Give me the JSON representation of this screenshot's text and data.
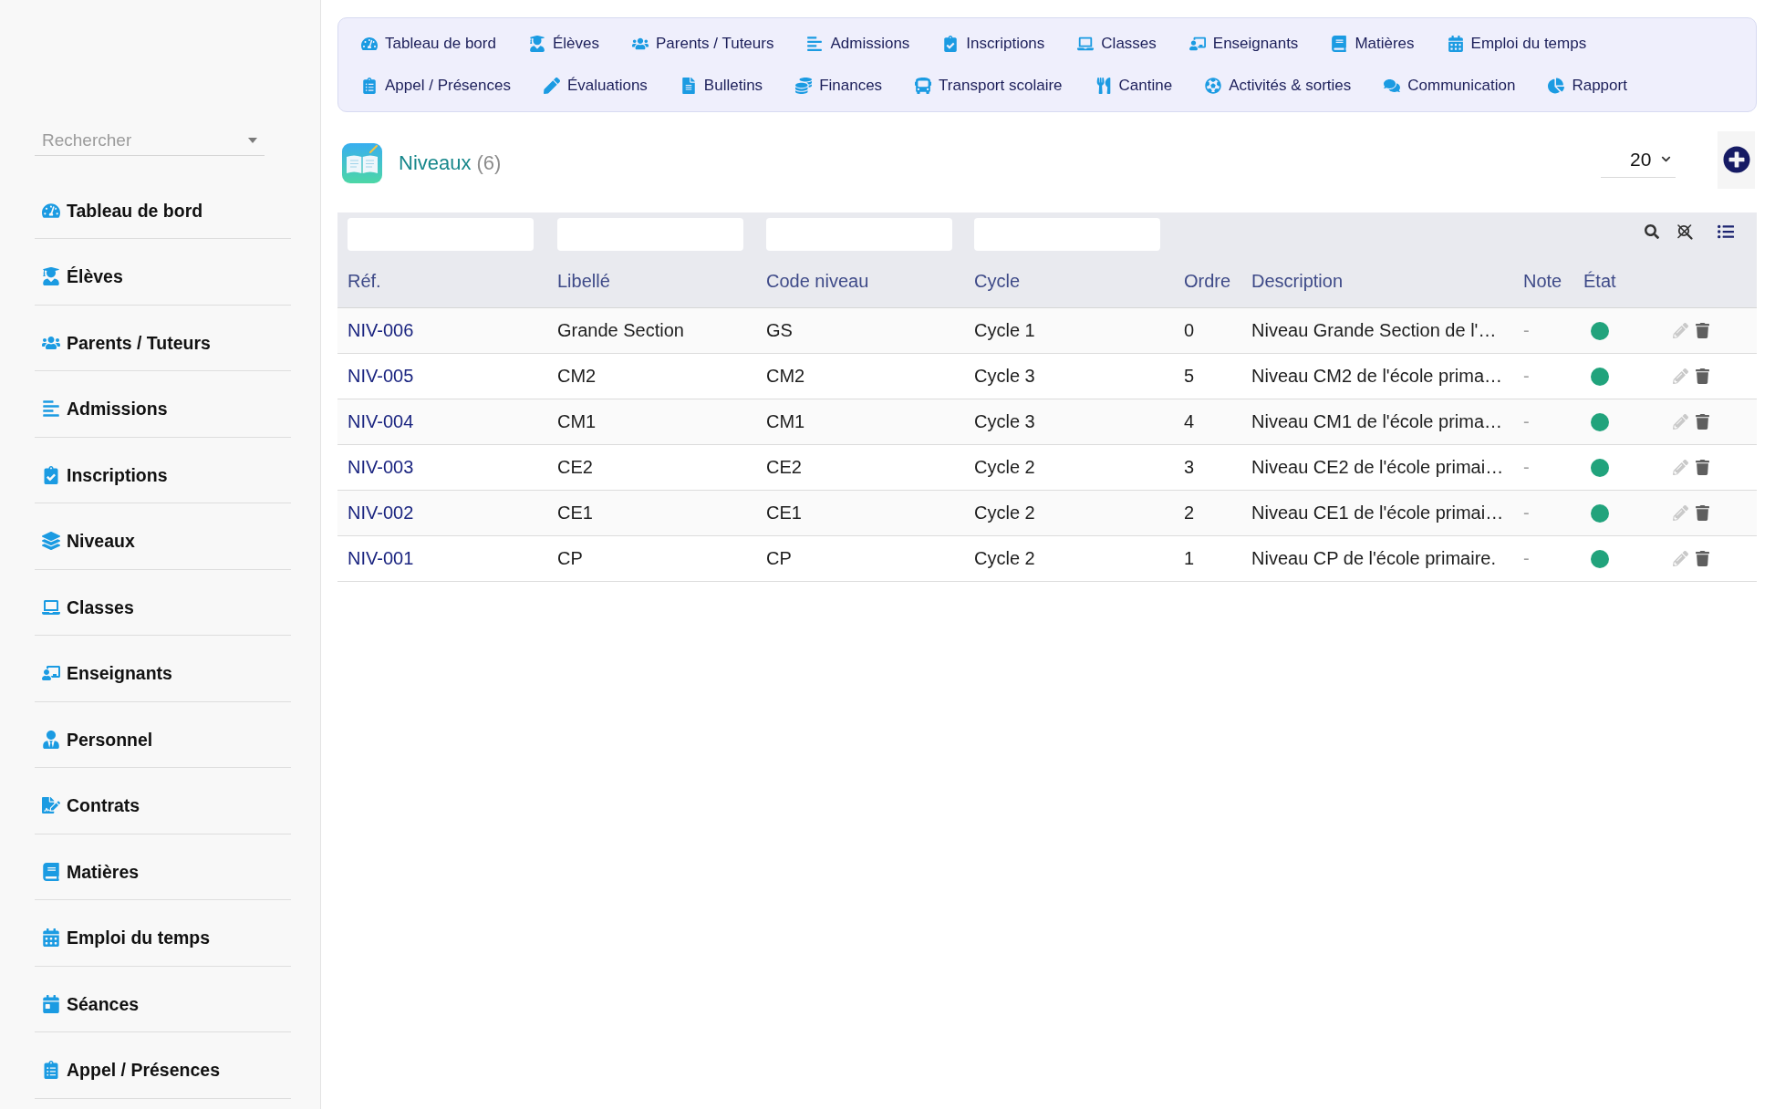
{
  "sidebar": {
    "search": {
      "placeholder": "Rechercher"
    },
    "items": [
      "Tableau de bord",
      "Élèves",
      "Parents / Tuteurs",
      "Admissions",
      "Inscriptions",
      "Niveaux",
      "Classes",
      "Enseignants",
      "Personnel",
      "Contrats",
      "Matières",
      "Emploi du temps",
      "Séances",
      "Appel / Présences"
    ]
  },
  "top_nav": {
    "rows": [
      [
        "Tableau de bord",
        "Élèves",
        "Parents / Tuteurs",
        "Admissions",
        "Inscriptions",
        "Classes",
        "Enseignants",
        "Matières",
        "Emploi du temps"
      ],
      [
        "Appel / Présences",
        "Évaluations",
        "Bulletins",
        "Finances",
        "Transport scolaire",
        "Cantine",
        "Activités & sorties",
        "Communication",
        "Rapport"
      ]
    ]
  },
  "page_header": {
    "title": "Niveaux",
    "count": "(6)",
    "page_size": "20"
  },
  "table": {
    "columns": [
      {
        "label": "Réf.",
        "filter": true
      },
      {
        "label": "Libellé",
        "filter": true
      },
      {
        "label": "Code niveau",
        "filter": true
      },
      {
        "label": "Cycle",
        "filter": true
      },
      {
        "label": "Ordre",
        "filter": false
      },
      {
        "label": "Description",
        "filter": false
      },
      {
        "label": "Note",
        "filter": false
      },
      {
        "label": "État",
        "filter": false
      }
    ],
    "rows": [
      {
        "ref": "NIV-006",
        "label": "Grande Section",
        "code": "GS",
        "cycle": "Cycle 1",
        "order": "0",
        "description": "Niveau Grande Section de l'…",
        "note": "-",
        "active": true
      },
      {
        "ref": "NIV-005",
        "label": "CM2",
        "code": "CM2",
        "cycle": "Cycle 3",
        "order": "5",
        "description": "Niveau CM2 de l'école prima…",
        "note": "-",
        "active": true
      },
      {
        "ref": "NIV-004",
        "label": "CM1",
        "code": "CM1",
        "cycle": "Cycle 3",
        "order": "4",
        "description": "Niveau CM1 de l'école prima…",
        "note": "-",
        "active": true
      },
      {
        "ref": "NIV-003",
        "label": "CE2",
        "code": "CE2",
        "cycle": "Cycle 2",
        "order": "3",
        "description": "Niveau CE2 de l'école primai…",
        "note": "-",
        "active": true
      },
      {
        "ref": "NIV-002",
        "label": "CE1",
        "code": "CE1",
        "cycle": "Cycle 2",
        "order": "2",
        "description": "Niveau CE1 de l'école primai…",
        "note": "-",
        "active": true
      },
      {
        "ref": "NIV-001",
        "label": "CP",
        "code": "CP",
        "cycle": "Cycle 2",
        "order": "1",
        "description": "Niveau CP de l'école primaire.",
        "note": "-",
        "active": true
      }
    ]
  }
}
